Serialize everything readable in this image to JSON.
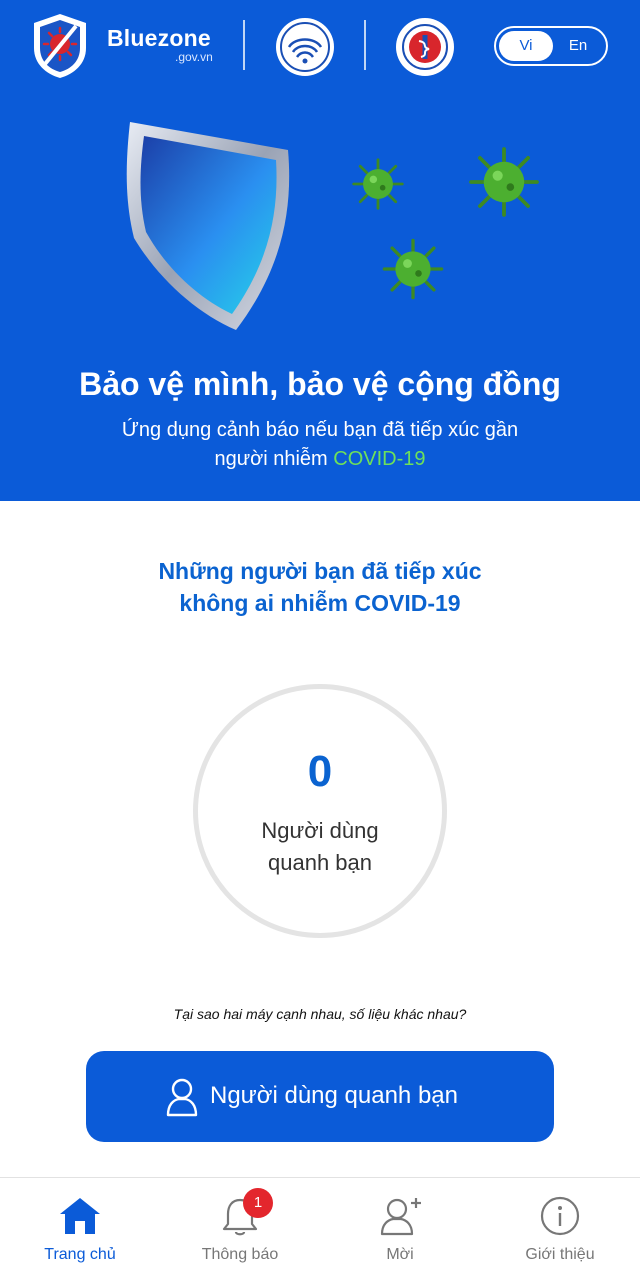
{
  "header": {
    "brand_name": "Bluezone",
    "brand_domain": ".gov.vn",
    "language": {
      "options": [
        "Vi",
        "En"
      ],
      "selected": "Vi"
    }
  },
  "hero": {
    "title": "Bảo vệ mình, bảo vệ cộng đồng",
    "subtitle_line1": "Ứng dụng cảnh báo nếu bạn đã tiếp xúc gần",
    "subtitle_line2_prefix": "người nhiễm ",
    "subtitle_line2_highlight": "COVID-19"
  },
  "main": {
    "headline_line1": "Những người bạn đã tiếp xúc",
    "headline_line2": "không ai nhiễm COVID-19",
    "count": "0",
    "count_label_line1": "Người dùng",
    "count_label_line2": "quanh bạn",
    "why_link": "Tại sao hai máy cạnh nhau, số liệu khác nhau?",
    "cta_label": "Người dùng quanh bạn"
  },
  "nav": {
    "items": [
      {
        "label": "Trang chủ",
        "icon": "home-icon",
        "active": true
      },
      {
        "label": "Thông báo",
        "icon": "bell-icon",
        "badge": "1"
      },
      {
        "label": "Mời",
        "icon": "add-user-icon"
      },
      {
        "label": "Giới thiệu",
        "icon": "info-icon"
      }
    ]
  },
  "colors": {
    "brand_blue": "#0b5bd8",
    "headline_blue": "#0b63d0",
    "covid_green": "#6ee05a",
    "badge_red": "#e3262d"
  }
}
